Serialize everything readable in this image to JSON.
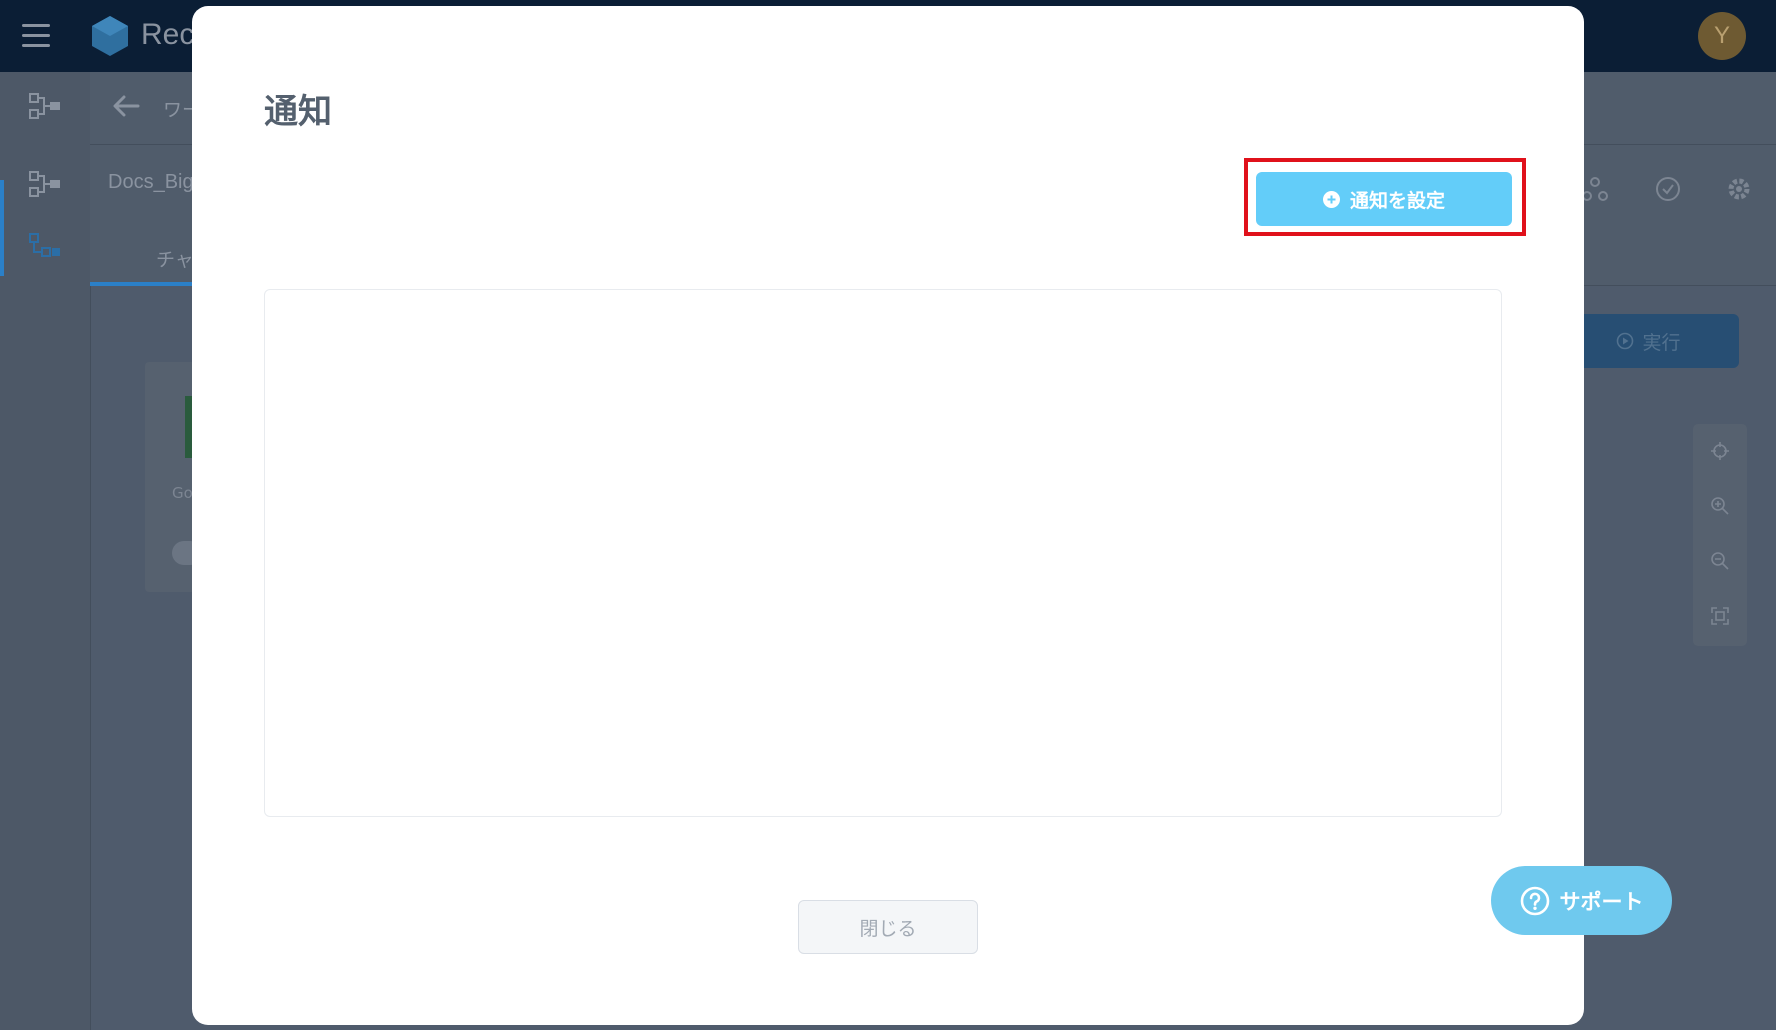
{
  "app": {
    "name": "Rec",
    "avatar_initial": "Y"
  },
  "breadcrumb": {
    "text": "ワー"
  },
  "workflow": {
    "name": "Docs_Big",
    "tab_label": "チャ",
    "run_label": "実行"
  },
  "canvas": {
    "card_text": "Go"
  },
  "modal": {
    "title": "通知",
    "set_button_label": "通知を設定",
    "close_button_label": "閉じる"
  },
  "support": {
    "label": "サポート"
  },
  "colors": {
    "topbar": "#0b1e35",
    "primary_button": "#63cdf9",
    "highlight": "#e0111b",
    "support": "#6fc9ee"
  },
  "icons": [
    "hamburger-menu-icon",
    "logo-icon",
    "workflow-icon",
    "flow-icon",
    "back-arrow-icon",
    "webhook-icon",
    "clock-icon",
    "gear-icon",
    "play-circle-icon",
    "crosshair-icon",
    "zoom-in-icon",
    "zoom-out-icon",
    "fit-screen-icon",
    "plus-circle-icon",
    "help-circle-icon"
  ]
}
